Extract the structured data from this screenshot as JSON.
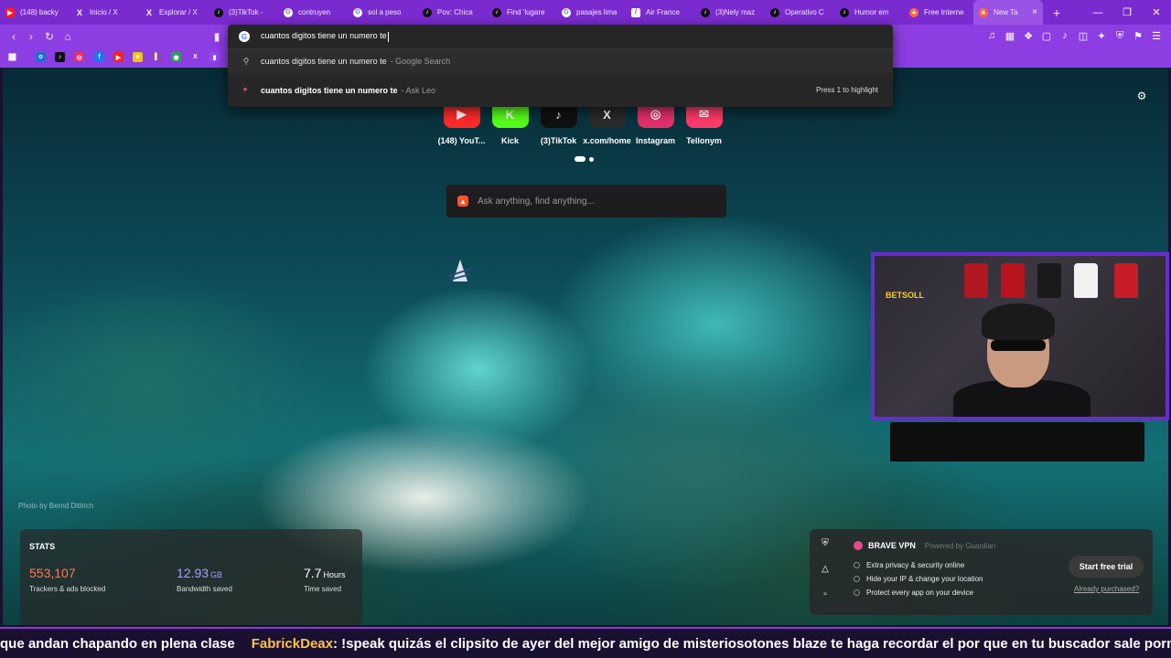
{
  "tabs": [
    {
      "label": "(148) backy",
      "icon": "youtube-icon",
      "kind": "yt"
    },
    {
      "label": "Inicio / X",
      "icon": "x-icon",
      "kind": "x"
    },
    {
      "label": "Explorar / X",
      "icon": "x-icon",
      "kind": "x"
    },
    {
      "label": "(3)TikTok -",
      "icon": "tiktok-icon",
      "kind": "tt"
    },
    {
      "label": "contruyen",
      "icon": "google-icon",
      "kind": "g"
    },
    {
      "label": "sol a peso",
      "icon": "google-icon",
      "kind": "g"
    },
    {
      "label": "Pov: Chica",
      "icon": "tiktok-icon",
      "kind": "tt"
    },
    {
      "label": "Find 'lugare",
      "icon": "tiktok-icon",
      "kind": "tt"
    },
    {
      "label": "pasajes lima",
      "icon": "google-icon",
      "kind": "g"
    },
    {
      "label": "Air France",
      "icon": "airfrance-icon",
      "kind": "af"
    },
    {
      "label": "(3)Nely maz",
      "icon": "tiktok-icon",
      "kind": "tt"
    },
    {
      "label": "Operativo C",
      "icon": "tiktok-icon",
      "kind": "tt"
    },
    {
      "label": "Humor em",
      "icon": "tiktok-icon",
      "kind": "tt"
    },
    {
      "label": "Free Interne",
      "icon": "brave-icon",
      "kind": "br"
    },
    {
      "label": "New Ta",
      "icon": "brave-shield-icon",
      "kind": "br",
      "active": true
    }
  ],
  "omnibox": {
    "typed": "cuantos digitos tiene un numero te",
    "suggestion_google": "cuantos digitos tiene un numero te",
    "suggestion_google_source": "- Google Search",
    "suggestion_leo": "cuantos digitos tiene un numero te",
    "suggestion_leo_source": "- Ask Leo",
    "hint": "Press 1 to highlight"
  },
  "top_sites": [
    {
      "label": "(148) YouT...",
      "color": "#ff2a2a",
      "glyph": "▶"
    },
    {
      "label": "Kick",
      "color": "#53fc18",
      "glyph": "K"
    },
    {
      "label": "(3)TikTok",
      "color": "#111111",
      "glyph": "♪"
    },
    {
      "label": "x.com/home",
      "color": "#2a2a2a",
      "glyph": "X"
    },
    {
      "label": "Instagram",
      "color": "#e1306c",
      "glyph": "◎"
    },
    {
      "label": "Tellonym",
      "color": "#ff3b6b",
      "glyph": "✉"
    }
  ],
  "search_placeholder": "Ask anything, find anything...",
  "photo_credit": "Photo by Bernd Dittrich",
  "stats": {
    "heading": "STATS",
    "trackers_value": "553,107",
    "trackers_caption": "Trackers & ads blocked",
    "bandwidth_value": "12.93",
    "bandwidth_unit": "GB",
    "bandwidth_caption": "Bandwidth saved",
    "time_value": "7.7",
    "time_unit": "Hours",
    "time_caption": "Time saved"
  },
  "vpn": {
    "title": "BRAVE VPN",
    "powered": "Powered by Guardian",
    "features": [
      "Extra privacy & security online",
      "Hide your IP & change your location",
      "Protect every app on your device"
    ],
    "cta": "Start free trial",
    "already": "Already purchased?"
  },
  "webcam": {
    "overlay_text": "BETSOLL"
  },
  "chat": {
    "prev_tail": "que andan chapando en plena clase",
    "user": "FabrickDeax",
    "message": ": !speak quizás el clipsito de ayer del mejor amigo de misteriosotones blaze te haga recordar el por que en tu buscador sale pornhub"
  }
}
